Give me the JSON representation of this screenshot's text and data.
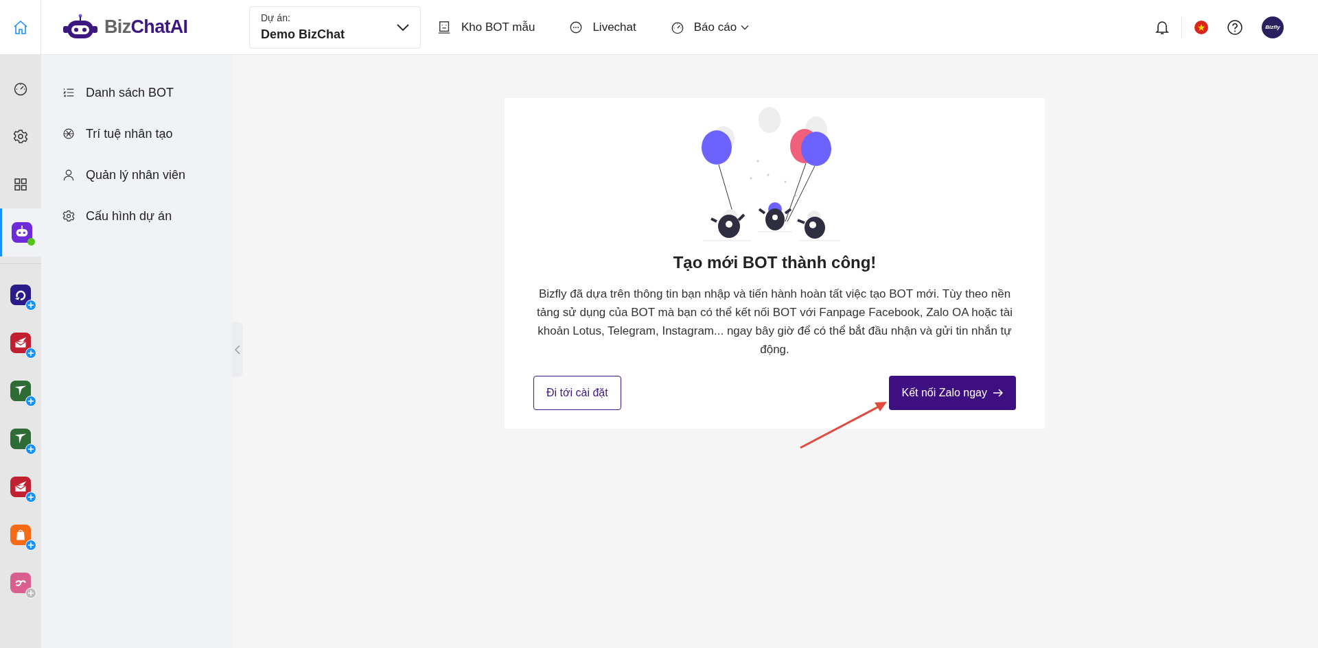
{
  "logo": {
    "parts": [
      "Biz",
      "ChatAI"
    ]
  },
  "project_select": {
    "label": "Dự án:",
    "value": "Demo BizChat"
  },
  "nav": [
    {
      "kind": "template",
      "label": "Kho BOT mẫu",
      "dropdown": false
    },
    {
      "kind": "chat",
      "label": "Livechat",
      "dropdown": false
    },
    {
      "kind": "gauge",
      "label": "Báo cáo",
      "dropdown": true
    }
  ],
  "header_right": {
    "avatar_text": "Bizfly"
  },
  "rail": {
    "home_selected": true,
    "items": [
      {
        "kind": "gauge",
        "selected": false
      },
      {
        "kind": "gear",
        "selected": false
      },
      {
        "kind": "grid",
        "selected": false
      },
      {
        "kind": "bot",
        "selected": true,
        "color": "#6d2bd9",
        "online": true
      }
    ],
    "apps": [
      {
        "kind": "loop",
        "color": "#2a1a8a",
        "add_enabled": true
      },
      {
        "kind": "mail",
        "color": "#c0202f",
        "add_enabled": true
      },
      {
        "kind": "plane",
        "color": "#2f6b35",
        "add_enabled": true
      },
      {
        "kind": "plane",
        "color": "#2f6b35",
        "add_enabled": true
      },
      {
        "kind": "mail",
        "color": "#c0202f",
        "add_enabled": true
      },
      {
        "kind": "bag",
        "color": "#f56a14",
        "add_enabled": true
      },
      {
        "kind": "heart",
        "color": "#d9608e",
        "add_enabled": false
      }
    ]
  },
  "side_menu": [
    {
      "kind": "list",
      "label": "Danh sách BOT"
    },
    {
      "kind": "ai",
      "label": "Trí tuệ nhân tạo"
    },
    {
      "kind": "user",
      "label": "Quản lý nhân viên"
    },
    {
      "kind": "gear",
      "label": "Cấu hình dự án"
    }
  ],
  "card": {
    "title": "Tạo mới BOT thành công!",
    "text": "Bizfly đã dựa trên thông tin bạn nhập và tiến hành hoàn tất việc tạo BOT mới. Tùy theo nền tảng sử dụng của BOT mà bạn có thể kết nối BOT với Fanpage Facebook, Zalo OA hoặc tài khoản Lotus, Telegram, Instagram... ngay bây giờ để có thể bắt đầu nhận và gửi tin nhắn tự động.",
    "secondary_button": "Đi tới cài đặt",
    "primary_button": "Kết nối Zalo ngay"
  }
}
